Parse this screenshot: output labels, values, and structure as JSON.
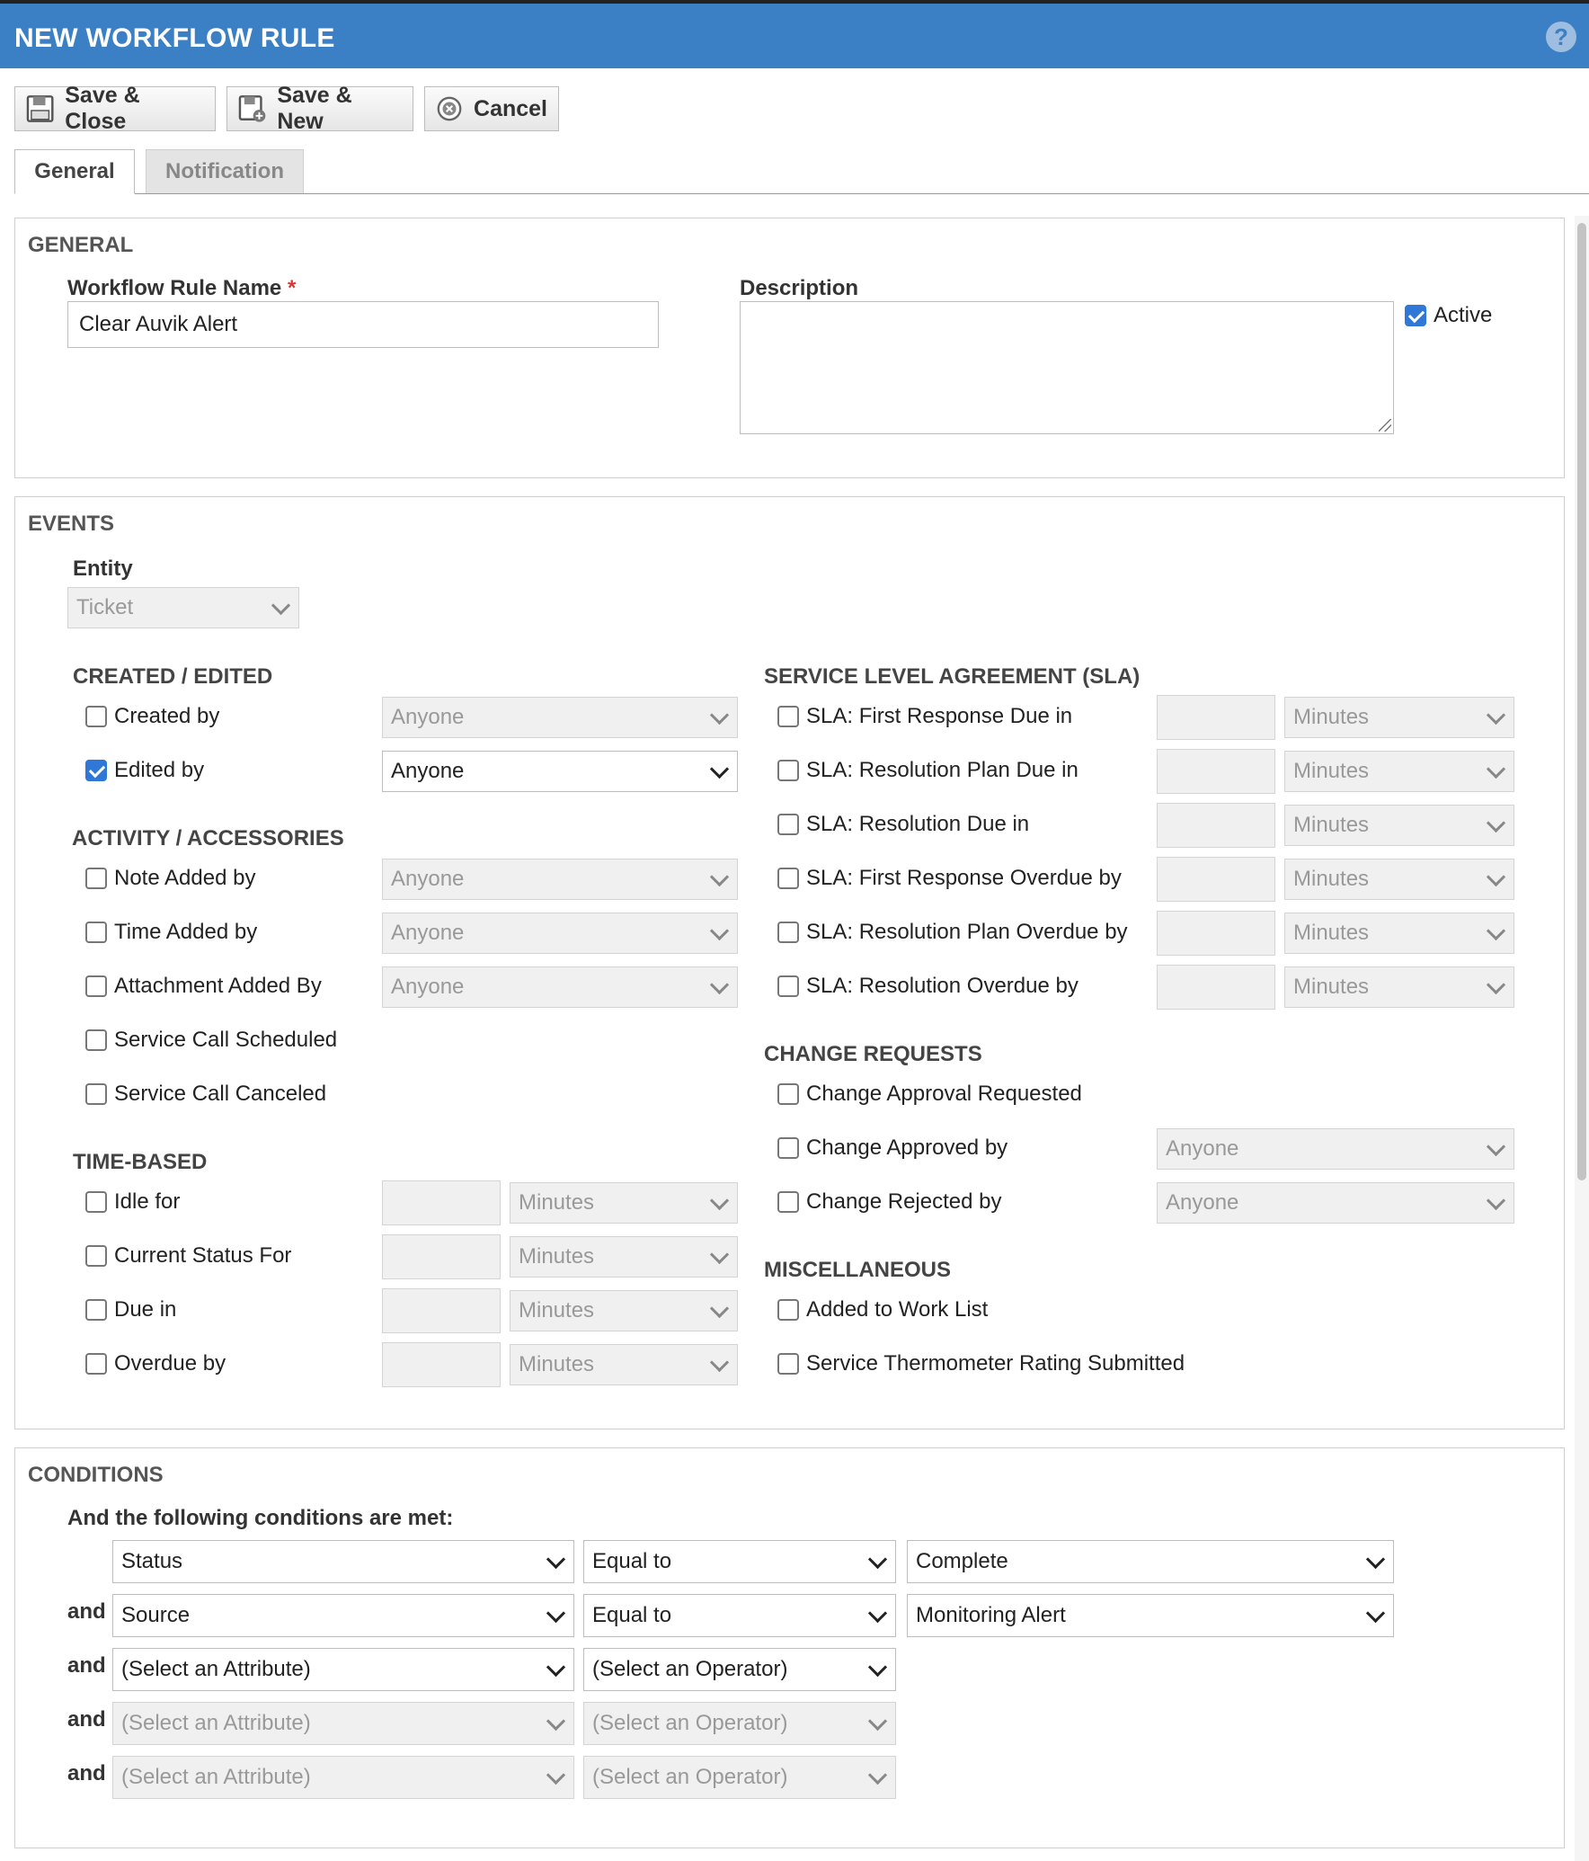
{
  "header": {
    "title": "NEW WORKFLOW RULE",
    "help_icon": "question-circle-icon"
  },
  "toolbar": {
    "save_close": "Save & Close",
    "save_new": "Save & New",
    "cancel": "Cancel"
  },
  "tabs": {
    "general": "General",
    "notification": "Notification"
  },
  "general": {
    "section_title": "GENERAL",
    "name_label": "Workflow Rule Name",
    "required_mark": "*",
    "name_value": "Clear Auvik Alert",
    "description_label": "Description",
    "description_value": "",
    "active_label": "Active",
    "active_checked": true
  },
  "events": {
    "section_title": "EVENTS",
    "entity_label": "Entity",
    "entity_value": "Ticket",
    "created_edited": {
      "title": "CREATED / EDITED",
      "created_by": "Created by",
      "created_by_value": "Anyone",
      "edited_by": "Edited by",
      "edited_by_value": "Anyone",
      "edited_checked": true
    },
    "activity": {
      "title": "ACTIVITY / ACCESSORIES",
      "note_added": "Note Added by",
      "note_value": "Anyone",
      "time_added": "Time Added by",
      "time_value": "Anyone",
      "attachment_added": "Attachment Added By",
      "attachment_value": "Anyone",
      "service_call_scheduled": "Service Call Scheduled",
      "service_call_canceled": "Service Call Canceled"
    },
    "time_based": {
      "title": "TIME-BASED",
      "idle_for": "Idle for",
      "current_status": "Current Status For",
      "due_in": "Due in",
      "overdue_by": "Overdue by",
      "unit": "Minutes"
    },
    "sla": {
      "title": "SERVICE LEVEL AGREEMENT (SLA)",
      "items": [
        "SLA: First Response Due in",
        "SLA: Resolution Plan Due in",
        "SLA: Resolution Due in",
        "SLA: First Response Overdue by",
        "SLA: Resolution Plan Overdue by",
        "SLA: Resolution Overdue by"
      ],
      "unit": "Minutes"
    },
    "change_requests": {
      "title": "CHANGE REQUESTS",
      "approval_requested": "Change Approval Requested",
      "approved_by": "Change Approved by",
      "approved_value": "Anyone",
      "rejected_by": "Change Rejected by",
      "rejected_value": "Anyone"
    },
    "misc": {
      "title": "MISCELLANEOUS",
      "added_work_list": "Added to Work List",
      "thermometer": "Service Thermometer Rating Submitted"
    }
  },
  "conditions": {
    "section_title": "CONDITIONS",
    "intro": "And the following conditions are met:",
    "and_label": "and",
    "rows": [
      {
        "attribute": "Status",
        "operator": "Equal to",
        "value": "Complete"
      },
      {
        "attribute": "Source",
        "operator": "Equal to",
        "value": "Monitoring Alert"
      },
      {
        "attribute": "(Select an Attribute)",
        "operator": "(Select an Operator)"
      },
      {
        "attribute": "(Select an Attribute)",
        "operator": "(Select an Operator)"
      },
      {
        "attribute": "(Select an Attribute)",
        "operator": "(Select an Operator)"
      }
    ]
  }
}
